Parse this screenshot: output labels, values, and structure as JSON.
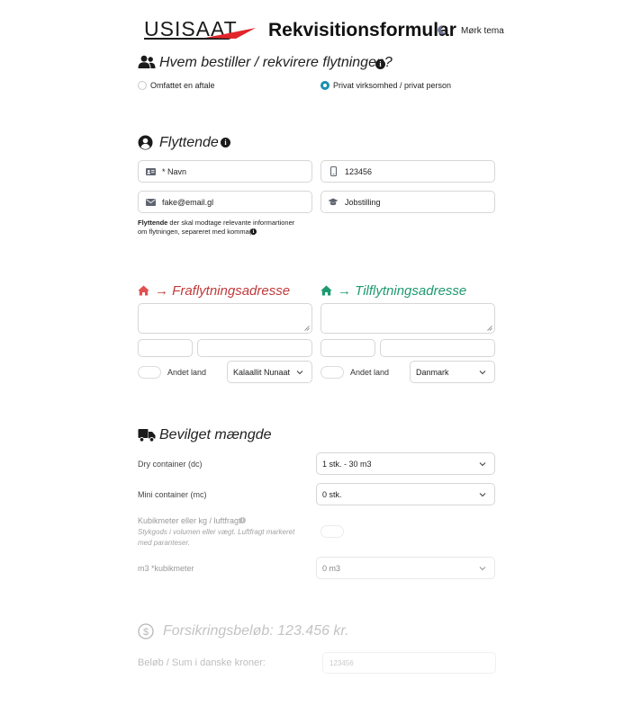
{
  "header": {
    "logo_text": "USISAAT",
    "title": "Rekvisitionsformular",
    "dark_theme_label": "Mørk tema"
  },
  "orderer": {
    "title": "Hvem bestiller / rekvirere flytningen?",
    "options": [
      {
        "label": "Omfattet en aftale",
        "selected": false
      },
      {
        "label": "Privat virksomhed / privat person",
        "selected": true
      }
    ]
  },
  "movers": {
    "title": "Flyttende",
    "name_placeholder": "* Navn",
    "phone_value": "123456",
    "email_value": "fake@email.gl",
    "job_placeholder": "Jobstilling",
    "help_bold": "Flyttende",
    "help_text_1": " der skal modtage relevante informartioner",
    "help_text_2": "om flytningen, separeret med komma(,)"
  },
  "from_address": {
    "arrow": "→",
    "title": "Fraflytningsadresse",
    "other_country_label": "Andet land",
    "country": "Kalaallit Nunaat",
    "color": "#c13a3a"
  },
  "to_address": {
    "arrow": "→",
    "title": "Tilflytningsadresse",
    "other_country_label": "Andet land",
    "country": "Danmark",
    "color": "#1f9a6f"
  },
  "granted": {
    "title": "Bevilget mængde",
    "dry_label": "Dry container (dc)",
    "dry_value": "1 stk. - 30 m3",
    "mini_label": "Mini container (mc)",
    "mini_value": "0 stk.",
    "cbm_label": "Kubikmeter eller kg / luftfragt",
    "cbm_hint_1": "Stykgods i volumen eller vægt. Luftfragt markeret",
    "cbm_hint_2": "med paranteser.",
    "m3_label": "m3 *kubikmeter",
    "m3_value": "0 m3"
  },
  "insurance": {
    "title": "Forsikringsbeløb: 123.456 kr.",
    "amount_label": "Beløb / Sum i danske kroner:",
    "amount_placeholder": "123456"
  }
}
